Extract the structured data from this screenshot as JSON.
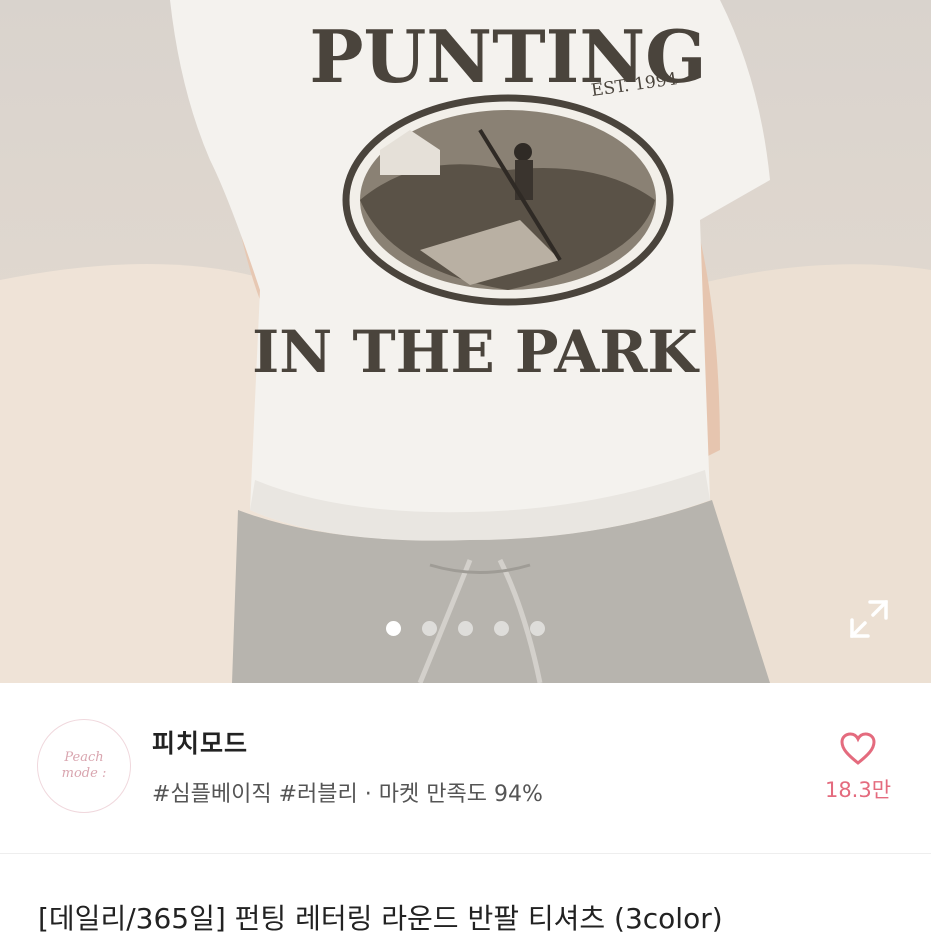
{
  "hero": {
    "shirt_print_top": "PUNTING",
    "shirt_print_est": "EST. 1994",
    "shirt_print_bottom": "IN THE PARK",
    "carousel_total": 5,
    "carousel_active": 1
  },
  "shop": {
    "logo_line1": "Peach",
    "logo_line2": "mode :",
    "name": "피치모드",
    "tags": "#심플베이직 #러블리 · 마켓 만족도 94%",
    "likes": "18.3만"
  },
  "product": {
    "title": "[데일리/365일] 펀팅 레터링 라운드 반팔 티셔츠 (3color)"
  },
  "colors": {
    "accent": "#e46b7e",
    "print": "#4a443c"
  }
}
